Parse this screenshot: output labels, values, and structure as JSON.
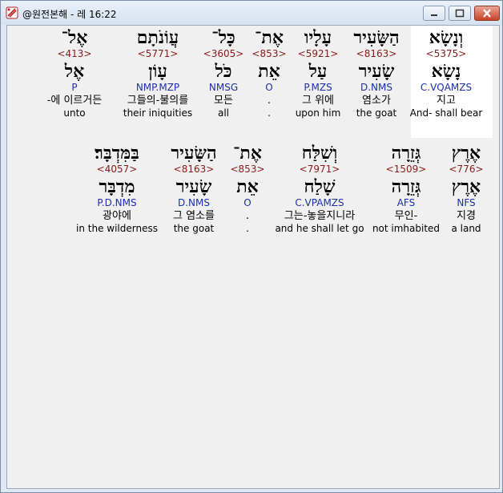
{
  "window": {
    "title": "@원전본해 - 레 16:22"
  },
  "row1": [
    {
      "heb": "וְנָשָׂא",
      "strong": "<5375>",
      "lemma": "נָשָׂא",
      "parse": "C.VQAMZS",
      "kor": "지고",
      "eng": "And- shall bear"
    },
    {
      "heb": "הַשָּׂעִיר",
      "strong": "<8163>",
      "lemma": "שָׂעִיר",
      "parse": "D.NMS",
      "kor": "염소가",
      "eng": "the goat"
    },
    {
      "heb": "עָלָיו",
      "strong": "<5921>",
      "lemma": "עַל",
      "parse": "P.MZS",
      "kor": "그 위에",
      "eng": "upon him"
    },
    {
      "heb": "אֶת־",
      "strong": "<853>",
      "lemma": "אֵת",
      "parse": "O",
      "kor": ".",
      "eng": "."
    },
    {
      "heb": "כָּל־",
      "strong": "<3605>",
      "lemma": "כֹּל",
      "parse": "NMSG",
      "kor": "모든",
      "eng": "all"
    },
    {
      "heb": "עֲוֹנֹתָם",
      "strong": "<5771>",
      "lemma": "עָוֹן",
      "parse": "NMP.MZP",
      "kor": "그들의-불의를",
      "eng": "their iniquities"
    },
    {
      "heb": "אֶל־",
      "strong": "<413>",
      "lemma": "אֶל",
      "parse": "P",
      "kor": "-에 이르거든",
      "eng": "unto"
    }
  ],
  "row2": [
    {
      "heb": "אֶרֶץ",
      "strong": "<776>",
      "lemma": "אֶרֶץ",
      "parse": "NFS",
      "kor": "지경",
      "eng": "a land"
    },
    {
      "heb": "גְּזֵרָה",
      "strong": "<1509>",
      "lemma": "גְּזֵרָה",
      "parse": "AFS",
      "kor": "무인-",
      "eng": "not imhabited"
    },
    {
      "heb": "וְשִׁלַּח",
      "strong": "<7971>",
      "lemma": "שָׁלַח",
      "parse": "C.VPAMZS",
      "kor": "그는-놓을지니라",
      "eng": "and he shall let go"
    },
    {
      "heb": "אֶת־",
      "strong": "<853>",
      "lemma": "אֵת",
      "parse": "O",
      "kor": ".",
      "eng": "."
    },
    {
      "heb": "הַשָּׂעִיר",
      "strong": "<8163>",
      "lemma": "שָׂעִיר",
      "parse": "D.NMS",
      "kor": "그 염소를",
      "eng": "the goat"
    },
    {
      "heb": "בַּמִּדְבָּר׃",
      "strong": "<4057>",
      "lemma": "מִדְבָּר",
      "parse": "P.D.NMS",
      "kor": "광야에",
      "eng": "in the wilderness"
    }
  ]
}
